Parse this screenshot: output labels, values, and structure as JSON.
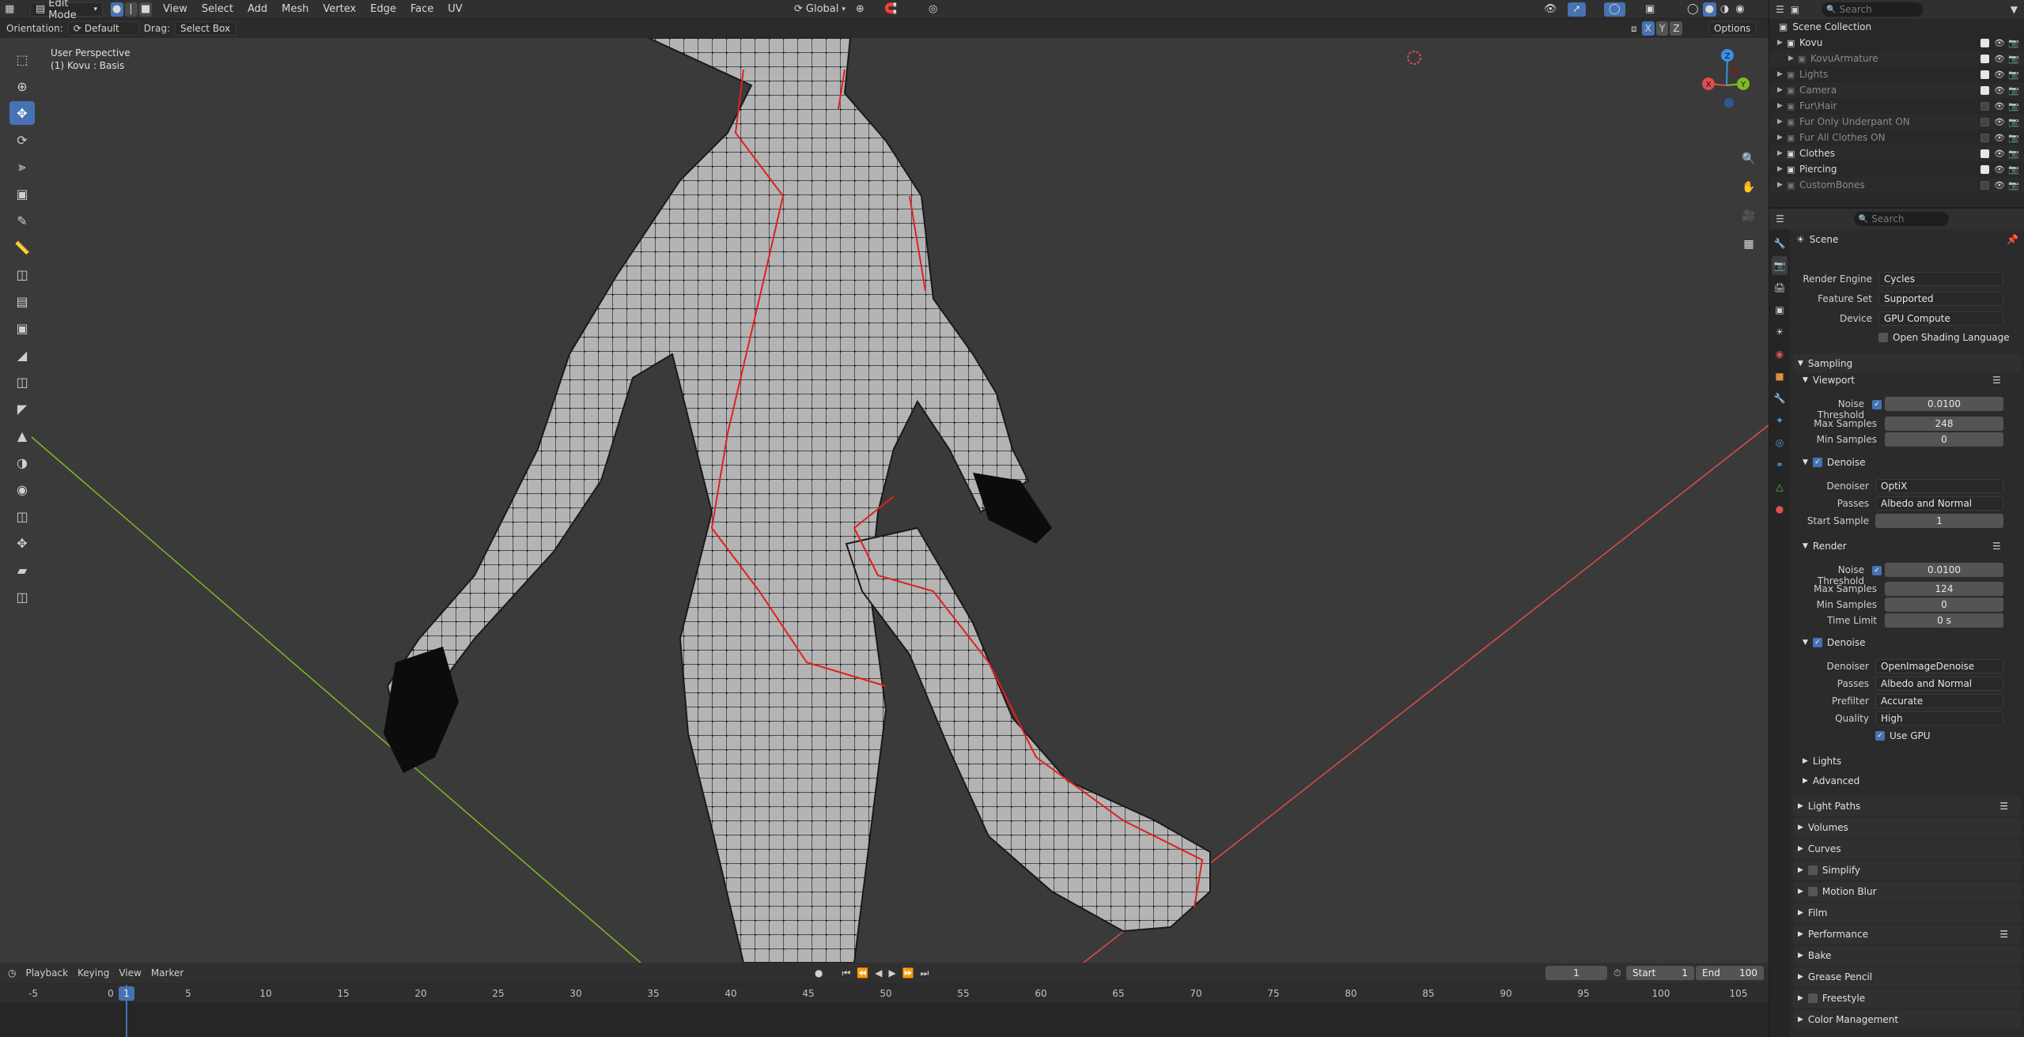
{
  "topbar": {
    "mode": "Edit Mode",
    "menus": [
      "View",
      "Select",
      "Add",
      "Mesh",
      "Vertex",
      "Edge",
      "Face",
      "UV"
    ],
    "transform_orientation": "Global",
    "search_placeholder": "Search"
  },
  "header2": {
    "orientation_label": "Orientation:",
    "orientation_value": "Default",
    "drag_label": "Drag:",
    "drag_value": "Select Box",
    "axes": [
      "X",
      "Y",
      "Z"
    ],
    "options_label": "Options"
  },
  "viewport": {
    "perspective": "User Perspective",
    "object_info": "(1) Kovu : Basis",
    "gizmo_axes": [
      "Z",
      "X",
      "Y"
    ],
    "colors": {
      "x_axis": "#e14b4b",
      "y_axis": "#7dbb22",
      "z_axis": "#3c8ee8",
      "seam": "#e02020"
    }
  },
  "timeline": {
    "menus": [
      "Playback",
      "Keying",
      "View",
      "Marker"
    ],
    "current_frame": "1",
    "start_label": "Start",
    "start_value": "1",
    "end_label": "End",
    "end_value": "100",
    "ticks": [
      "-5",
      "0",
      "5",
      "10",
      "15",
      "20",
      "25",
      "30",
      "35",
      "40",
      "45",
      "50",
      "55",
      "60",
      "65",
      "70",
      "75",
      "80",
      "85",
      "90",
      "95",
      "100",
      "105"
    ]
  },
  "outliner": {
    "search_placeholder": "Search",
    "root": "Scene Collection",
    "items": [
      {
        "name": "Kovu",
        "dim": false,
        "checked": true
      },
      {
        "name": "KovuArmature",
        "dim": true,
        "checked": true
      },
      {
        "name": "Lights",
        "dim": true,
        "checked": true
      },
      {
        "name": "Camera",
        "dim": true,
        "checked": true
      },
      {
        "name": "Fur\\Hair",
        "dim": true,
        "checked": false
      },
      {
        "name": "Fur Only Underpant ON",
        "dim": true,
        "checked": false
      },
      {
        "name": "Fur All Clothes ON",
        "dim": true,
        "checked": false
      },
      {
        "name": "Clothes",
        "dim": false,
        "checked": true
      },
      {
        "name": "Piercing",
        "dim": false,
        "checked": true
      },
      {
        "name": "CustomBones",
        "dim": true,
        "checked": false
      }
    ]
  },
  "properties": {
    "search_placeholder": "Search",
    "context": "Scene",
    "render_engine_label": "Render Engine",
    "render_engine": "Cycles",
    "feature_set_label": "Feature Set",
    "feature_set": "Supported",
    "device_label": "Device",
    "device": "GPU Compute",
    "osl_label": "Open Shading Language",
    "sampling": "Sampling",
    "viewport_panel": "Viewport",
    "noise_threshold_label": "Noise Threshold",
    "vp_noise_threshold": "0.0100",
    "max_samples_label": "Max Samples",
    "vp_max_samples": "248",
    "min_samples_label": "Min Samples",
    "vp_min_samples": "0",
    "denoise_label": "Denoise",
    "denoiser_label": "Denoiser",
    "vp_denoiser": "OptiX",
    "passes_label": "Passes",
    "vp_passes": "Albedo and Normal",
    "start_sample_label": "Start Sample",
    "vp_start_sample": "1",
    "render_panel": "Render",
    "r_noise_threshold": "0.0100",
    "r_max_samples": "124",
    "r_min_samples": "0",
    "time_limit_label": "Time Limit",
    "r_time_limit": "0 s",
    "r_denoiser": "OpenImageDenoise",
    "r_passes": "Albedo and Normal",
    "prefilter_label": "Prefilter",
    "r_prefilter": "Accurate",
    "quality_label": "Quality",
    "r_quality": "High",
    "use_gpu_label": "Use GPU",
    "sub_lights": "Lights",
    "sub_advanced": "Advanced",
    "panels": [
      "Light Paths",
      "Volumes",
      "Curves",
      "Simplify",
      "Motion Blur",
      "Film",
      "Performance",
      "Bake",
      "Grease Pencil",
      "Freestyle",
      "Color Management"
    ]
  }
}
